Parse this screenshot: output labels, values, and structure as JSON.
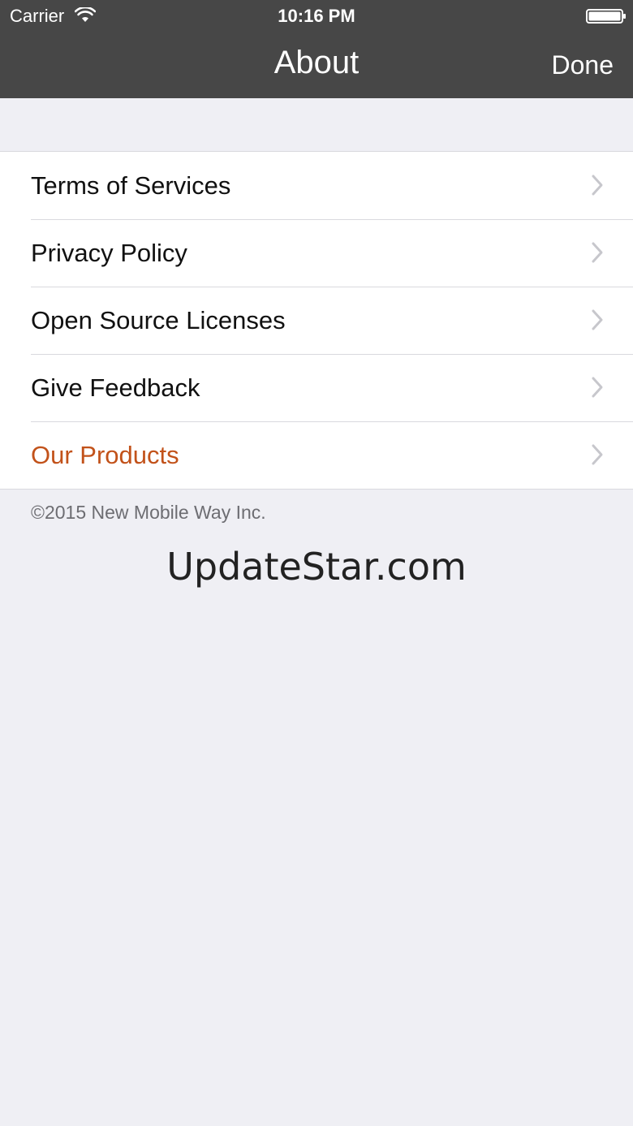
{
  "status_bar": {
    "carrier": "Carrier",
    "time": "10:16 PM"
  },
  "nav": {
    "title": "About",
    "done_label": "Done"
  },
  "list": {
    "items": [
      {
        "label": "Terms of Services",
        "icon": "chevron-right-icon"
      },
      {
        "label": "Privacy Policy",
        "icon": "chevron-right-icon"
      },
      {
        "label": "Open Source Licenses",
        "icon": "chevron-right-icon"
      },
      {
        "label": "Give Feedback",
        "icon": "chevron-right-icon"
      },
      {
        "label": "Our Products",
        "icon": "chevron-right-icon"
      }
    ]
  },
  "footer": {
    "copyright": "©2015 New Mobile Way Inc.",
    "watermark": "UpdateStar.com"
  },
  "colors": {
    "nav_background": "#474747",
    "page_background": "#efeff4",
    "accent": "#c2521a"
  }
}
